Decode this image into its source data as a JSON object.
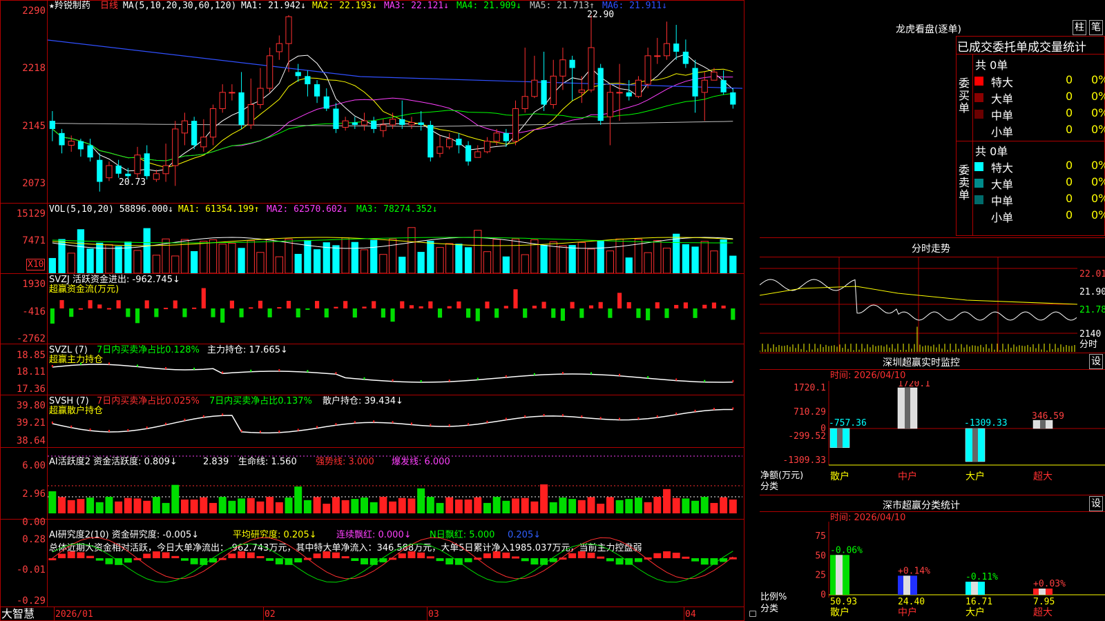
{
  "main_chart": {
    "stock_name": "★羚锐制药",
    "period": "日线",
    "ma_legend": {
      "label": "MA(5,10,20,30,60,120)",
      "ma1": "MA1: 21.942↓",
      "ma2": "MA2: 22.193↓",
      "ma3": "MA3: 22.121↓",
      "ma4": "MA4: 21.909↓",
      "ma5": "MA5: 21.713↑",
      "ma6": "MA6: 21.911↓"
    },
    "y_ticks": [
      "2290",
      "2218",
      "2145",
      "2073"
    ],
    "high_mark": "22.90",
    "low_mark": "20.73"
  },
  "vol_panel": {
    "legend": "VOL(5,10,20) 58896.000↓",
    "ma1": "MA1: 61354.199↑",
    "ma2": "MA2: 62570.602↓",
    "ma3": "MA3: 78274.352↓",
    "y_ticks": [
      "15129",
      "7471"
    ],
    "unit_badge": "X10"
  },
  "svzj_panel": {
    "legend": "SVZJ  活跃资金进出: -962.745↓",
    "sub": "超赢资金流(万元)",
    "y_ticks": [
      "1930",
      "-416",
      "-2762"
    ]
  },
  "svzl_panel": {
    "legend": "SVZL (7)",
    "text1": "7日内买卖净占比0.128%",
    "text2": "主力持仓: 17.665↓",
    "sub": "超赢主力持仓",
    "y_ticks": [
      "18.85",
      "18.11",
      "17.36"
    ]
  },
  "svsh_panel": {
    "legend": "SVSH (7)",
    "text1": "7日内买卖净占比0.025%",
    "text2": "7日内买卖净占比0.137%",
    "text3": "散户持仓: 39.434↓",
    "sub": "超赢散户持仓",
    "y_ticks": [
      "39.80",
      "39.21",
      "38.64"
    ]
  },
  "ai_active_panel": {
    "legend": "AI活跃度2 资金活跃度: 0.809↓",
    "v2": "2.839",
    "v3": "生命线: 1.560",
    "v4": "强势线: 3.000",
    "v5": "爆发线: 6.000",
    "y_ticks": [
      "6.00",
      "2.96",
      "0.00"
    ]
  },
  "ai_research_panel": {
    "legend": "AI研究度2(10) 资金研究度: -0.005↓",
    "v2": "平均研究度: 0.205↓",
    "v3": "连续飘红: 0.000↓",
    "v4": "N日飘红: 5.000",
    "v5": "0.205↓",
    "summary": "总体近期大资金相对活跃，今日大单净流出：-962.743万元，其中特大单净流入：346.588万元，大单5日累计净入1985.037万元，当前主力控盘弱",
    "y_ticks": [
      "0.28",
      "-0.01",
      "-0.29"
    ]
  },
  "x_axis": {
    "brand": "大智慧",
    "labels": [
      "2026/01",
      "02",
      "03",
      "04"
    ]
  },
  "right_panel": {
    "dragon_title": "龙虎看盘(逐单)",
    "btn1": "柱",
    "btn2": "笔",
    "header": "已成交委托单成交量统计",
    "buy": {
      "side_label": "委买单",
      "total": "共 0单",
      "rows": [
        {
          "name": "特大",
          "v": "0",
          "p": "0%",
          "color": "#ff0000"
        },
        {
          "name": "大单",
          "v": "0",
          "p": "0%",
          "color": "#8b0000"
        },
        {
          "name": "中单",
          "v": "0",
          "p": "0%",
          "color": "#6b0000"
        },
        {
          "name": "小单",
          "v": "0",
          "p": "0%",
          "color": "#000"
        }
      ]
    },
    "sell": {
      "side_label": "委卖单",
      "total": "共 0单",
      "rows": [
        {
          "name": "特大",
          "v": "0",
          "p": "0%",
          "color": "#00ffff"
        },
        {
          "name": "大单",
          "v": "0",
          "p": "0%",
          "color": "#008b8b"
        },
        {
          "name": "中单",
          "v": "0",
          "p": "0%",
          "color": "#006b6b"
        },
        {
          "name": "小单",
          "v": "0",
          "p": "0%",
          "color": "#000"
        }
      ]
    },
    "intraday": {
      "title": "分时走势",
      "y_ticks": [
        "22.01",
        "21.90",
        "21.78"
      ],
      "vol_tick": "2140",
      "vol_label": "分时"
    },
    "monitor": {
      "title": "深圳超赢实时监控",
      "btn": "设",
      "time": "时间: 2026/04/10",
      "y_ticks": [
        "1720.1",
        "710.29",
        "0",
        "-299.52",
        "-1309.33"
      ],
      "y_label": "净额(万元)",
      "x_label": "分类",
      "categories": [
        "散户",
        "中户",
        "大户",
        "超大"
      ],
      "values": [
        -757.36,
        1720.1,
        -1309.33,
        346.59
      ],
      "value_labels": [
        "-757.36",
        "1720.1",
        "-1309.33",
        "346.59"
      ]
    },
    "classify": {
      "title": "深市超赢分类统计",
      "btn": "设",
      "time": "时间: 2026/04/10",
      "y_ticks": [
        "75",
        "50",
        "25",
        "0"
      ],
      "y_label": "比例%",
      "x_label": "分类",
      "categories": [
        "散户",
        "中户",
        "大户",
        "超大"
      ],
      "values": [
        50.93,
        24.4,
        16.71,
        7.95
      ],
      "value_labels": [
        "50.93",
        "24.40",
        "16.71",
        "7.95"
      ],
      "change_labels": [
        "-0.06%",
        "+0.14%",
        "-0.11%",
        "+0.03%"
      ]
    }
  },
  "chart_data": [
    {
      "type": "candlestick",
      "title": "羚锐制药 日线",
      "ylim": [
        20.6,
        22.95
      ],
      "series": [
        {
          "name": "K",
          "values": [
            [
              21.6,
              21.5,
              21.72,
              21.35
            ],
            [
              21.45,
              21.3,
              21.5,
              21.2
            ],
            [
              21.3,
              21.35,
              21.42,
              21.22
            ],
            [
              21.35,
              21.25,
              21.38,
              21.16
            ],
            [
              21.3,
              21.15,
              21.38,
              21.1
            ],
            [
              21.12,
              20.85,
              21.2,
              20.73
            ],
            [
              20.9,
              21.05,
              21.1,
              20.86
            ],
            [
              21.05,
              20.95,
              21.12,
              20.9
            ],
            [
              20.95,
              20.92,
              21.02,
              20.88
            ],
            [
              20.95,
              21.18,
              21.28,
              20.9
            ],
            [
              21.2,
              20.92,
              21.3,
              20.88
            ],
            [
              20.88,
              20.95,
              21.0,
              20.85
            ],
            [
              20.95,
              21.05,
              21.32,
              20.85
            ],
            [
              21.05,
              21.5,
              21.6,
              20.8
            ],
            [
              21.45,
              21.6,
              21.7,
              21.3
            ],
            [
              21.6,
              21.3,
              21.65,
              21.25
            ],
            [
              21.28,
              21.4,
              21.62,
              21.22
            ],
            [
              21.4,
              21.75,
              21.8,
              21.3
            ],
            [
              21.75,
              21.95,
              22.05,
              21.7
            ],
            [
              21.95,
              21.95,
              22.05,
              21.85
            ],
            [
              21.95,
              21.55,
              22.2,
              21.5
            ],
            [
              21.55,
              21.8,
              22.12,
              21.5
            ],
            [
              21.8,
              22.0,
              22.25,
              21.75
            ],
            [
              22.0,
              22.4,
              22.5,
              21.95
            ],
            [
              22.45,
              22.55,
              22.65,
              22.35
            ],
            [
              22.55,
              22.88,
              22.9,
              22.2
            ],
            [
              22.2,
              22.15,
              22.3,
              22.08
            ],
            [
              22.15,
              22.05,
              22.22,
              21.9
            ],
            [
              22.05,
              21.9,
              22.1,
              21.82
            ],
            [
              21.9,
              21.75,
              22.0,
              21.72
            ],
            [
              21.75,
              21.5,
              21.82,
              21.45
            ],
            [
              21.52,
              21.6,
              21.65,
              21.48
            ],
            [
              21.58,
              21.55,
              21.65,
              21.5
            ],
            [
              21.55,
              21.6,
              21.7,
              21.48
            ],
            [
              21.6,
              21.5,
              21.65,
              21.45
            ],
            [
              21.48,
              21.55,
              21.62,
              21.4
            ],
            [
              21.55,
              21.62,
              21.7,
              21.5
            ],
            [
              21.62,
              21.55,
              21.85,
              21.5
            ],
            [
              21.55,
              21.58,
              21.65,
              21.5
            ],
            [
              21.58,
              21.55,
              21.72,
              21.48
            ],
            [
              21.55,
              21.15,
              21.6,
              21.1
            ],
            [
              21.2,
              21.28,
              21.42,
              21.15
            ],
            [
              21.28,
              21.38,
              21.45,
              21.25
            ],
            [
              21.38,
              21.3,
              21.45,
              21.2
            ],
            [
              21.3,
              21.1,
              21.35,
              21.05
            ],
            [
              21.15,
              21.22,
              21.3,
              21.15
            ],
            [
              21.22,
              21.35,
              21.4,
              21.2
            ],
            [
              21.35,
              21.45,
              21.5,
              21.3
            ],
            [
              21.45,
              21.35,
              21.5,
              21.28
            ],
            [
              21.35,
              21.75,
              21.85,
              21.3
            ],
            [
              21.75,
              21.9,
              22.5,
              21.7
            ],
            [
              21.9,
              22.1,
              22.4,
              21.88
            ],
            [
              22.1,
              21.8,
              22.45,
              21.72
            ],
            [
              21.8,
              22.15,
              22.35,
              21.75
            ],
            [
              22.15,
              22.35,
              22.5,
              21.98
            ],
            [
              22.35,
              22.25,
              22.4,
              21.85
            ],
            [
              21.95,
              21.98,
              22.15,
              21.82
            ],
            [
              21.98,
              22.5,
              22.9,
              21.95
            ],
            [
              22.25,
              21.6,
              22.3,
              21.55
            ],
            [
              21.65,
              21.95,
              22.05,
              21.3
            ],
            [
              21.95,
              21.95,
              22.3,
              21.6
            ],
            [
              21.95,
              21.9,
              22.1,
              21.85
            ],
            [
              21.9,
              22.1,
              22.15,
              21.88
            ],
            [
              22.05,
              22.4,
              22.5,
              22.0
            ],
            [
              22.4,
              22.4,
              22.62,
              22.3
            ],
            [
              22.4,
              22.55,
              22.82,
              22.35
            ],
            [
              22.55,
              22.45,
              22.78,
              22.35
            ],
            [
              22.45,
              22.3,
              22.6,
              22.25
            ],
            [
              22.25,
              21.9,
              22.35,
              21.7
            ],
            [
              21.95,
              22.1,
              22.2,
              21.6
            ],
            [
              22.1,
              22.2,
              22.25,
              22.1
            ],
            [
              22.1,
              21.95,
              22.22,
              21.92
            ],
            [
              21.95,
              21.8,
              22.0,
              21.75
            ]
          ]
        }
      ]
    },
    {
      "type": "bar",
      "title": "深圳超赢实时监控",
      "categories": [
        "散户",
        "中户",
        "大户",
        "超大"
      ],
      "values": [
        -757.36,
        1720.1,
        -1309.33,
        346.59
      ],
      "ylabel": "净额(万元)"
    },
    {
      "type": "bar",
      "title": "深市超赢分类统计",
      "categories": [
        "散户",
        "中户",
        "大户",
        "超大"
      ],
      "values": [
        50.93,
        24.4,
        16.71,
        7.95
      ],
      "ylabel": "比例%"
    }
  ]
}
